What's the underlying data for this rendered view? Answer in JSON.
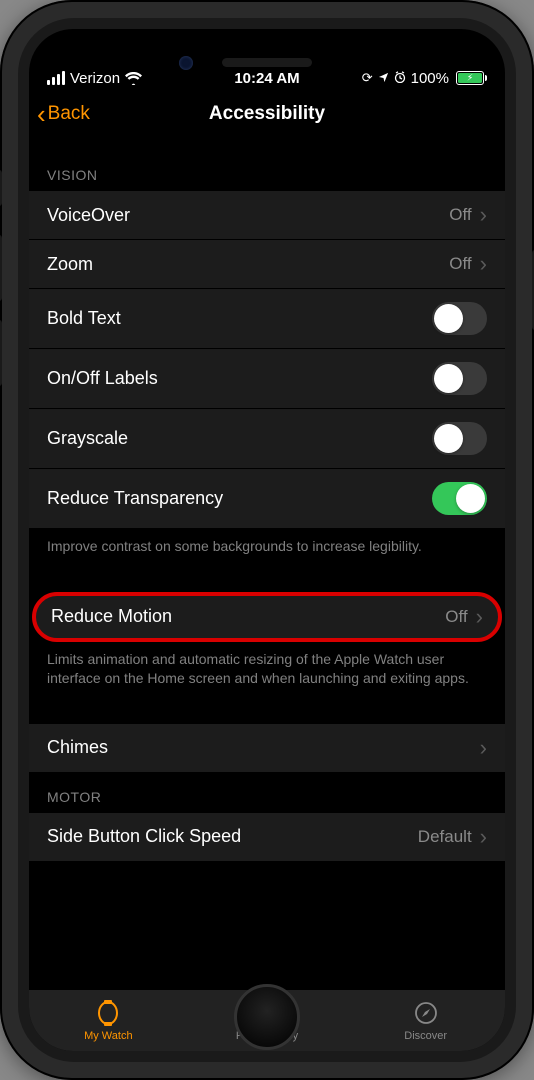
{
  "statusBar": {
    "carrier": "Verizon",
    "time": "10:24 AM",
    "batteryPct": "100%"
  },
  "nav": {
    "back": "Back",
    "title": "Accessibility"
  },
  "sections": {
    "vision": {
      "header": "VISION",
      "voiceover": {
        "label": "VoiceOver",
        "value": "Off"
      },
      "zoom": {
        "label": "Zoom",
        "value": "Off"
      },
      "boldText": {
        "label": "Bold Text"
      },
      "onOffLabels": {
        "label": "On/Off Labels"
      },
      "grayscale": {
        "label": "Grayscale"
      },
      "reduceTransparency": {
        "label": "Reduce Transparency"
      },
      "footer1": "Improve contrast on some backgrounds to increase legibility.",
      "reduceMotion": {
        "label": "Reduce Motion",
        "value": "Off"
      },
      "footer2": "Limits animation and automatic resizing of the Apple Watch user interface on the Home screen and when launching and exiting apps.",
      "chimes": {
        "label": "Chimes"
      }
    },
    "motor": {
      "header": "MOTOR",
      "sideButton": {
        "label": "Side Button Click Speed",
        "value": "Default"
      }
    }
  },
  "tabs": {
    "myWatch": "My Watch",
    "faceGallery": "Face Gallery",
    "discover": "Discover"
  }
}
